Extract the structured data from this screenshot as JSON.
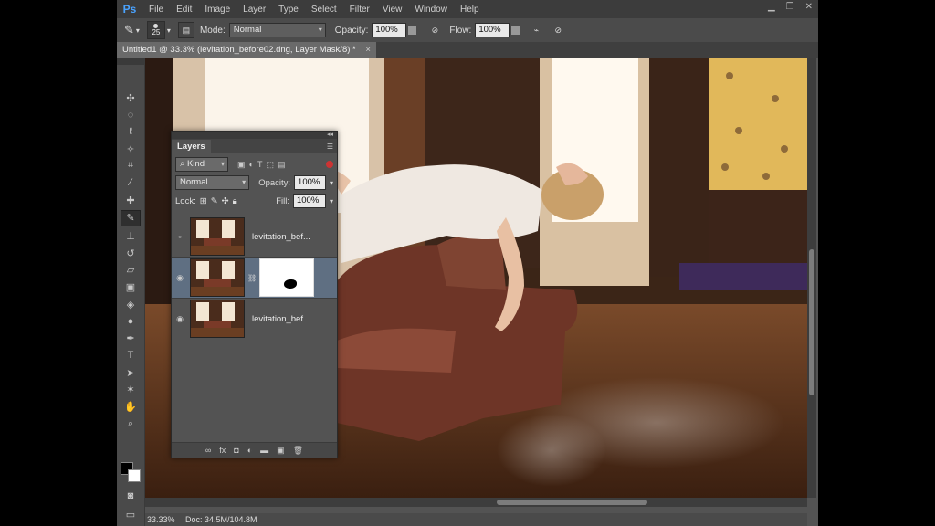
{
  "menubar": {
    "logo": "Ps",
    "items": [
      "File",
      "Edit",
      "Image",
      "Layer",
      "Type",
      "Select",
      "Filter",
      "View",
      "Window",
      "Help"
    ]
  },
  "options": {
    "brush_size": "25",
    "mode_label": "Mode:",
    "mode_value": "Normal",
    "opacity_label": "Opacity:",
    "opacity_value": "100%",
    "flow_label": "Flow:",
    "flow_value": "100%"
  },
  "document": {
    "tab_title": "Untitled1 @ 33.3% (levitation_before02.dng, Layer Mask/8) *"
  },
  "layers_panel": {
    "title": "Layers",
    "filter_kind": "Kind",
    "blend_mode": "Normal",
    "opacity_label": "Opacity:",
    "opacity_value": "100%",
    "lock_label": "Lock:",
    "fill_label": "Fill:",
    "fill_value": "100%",
    "layers": [
      {
        "name": "levitation_bef...",
        "visible": false,
        "selected": false,
        "has_mask": false
      },
      {
        "name": "",
        "visible": true,
        "selected": true,
        "has_mask": true
      },
      {
        "name": "levitation_bef...",
        "visible": true,
        "selected": false,
        "has_mask": false
      }
    ]
  },
  "status": {
    "zoom": "33.33%",
    "doc_info": "Doc: 34.5M/104.8M"
  },
  "colors": {
    "foreground": "#000000",
    "background": "#ffffff",
    "panel_bg": "#535353",
    "selection": "#5f6f82"
  }
}
